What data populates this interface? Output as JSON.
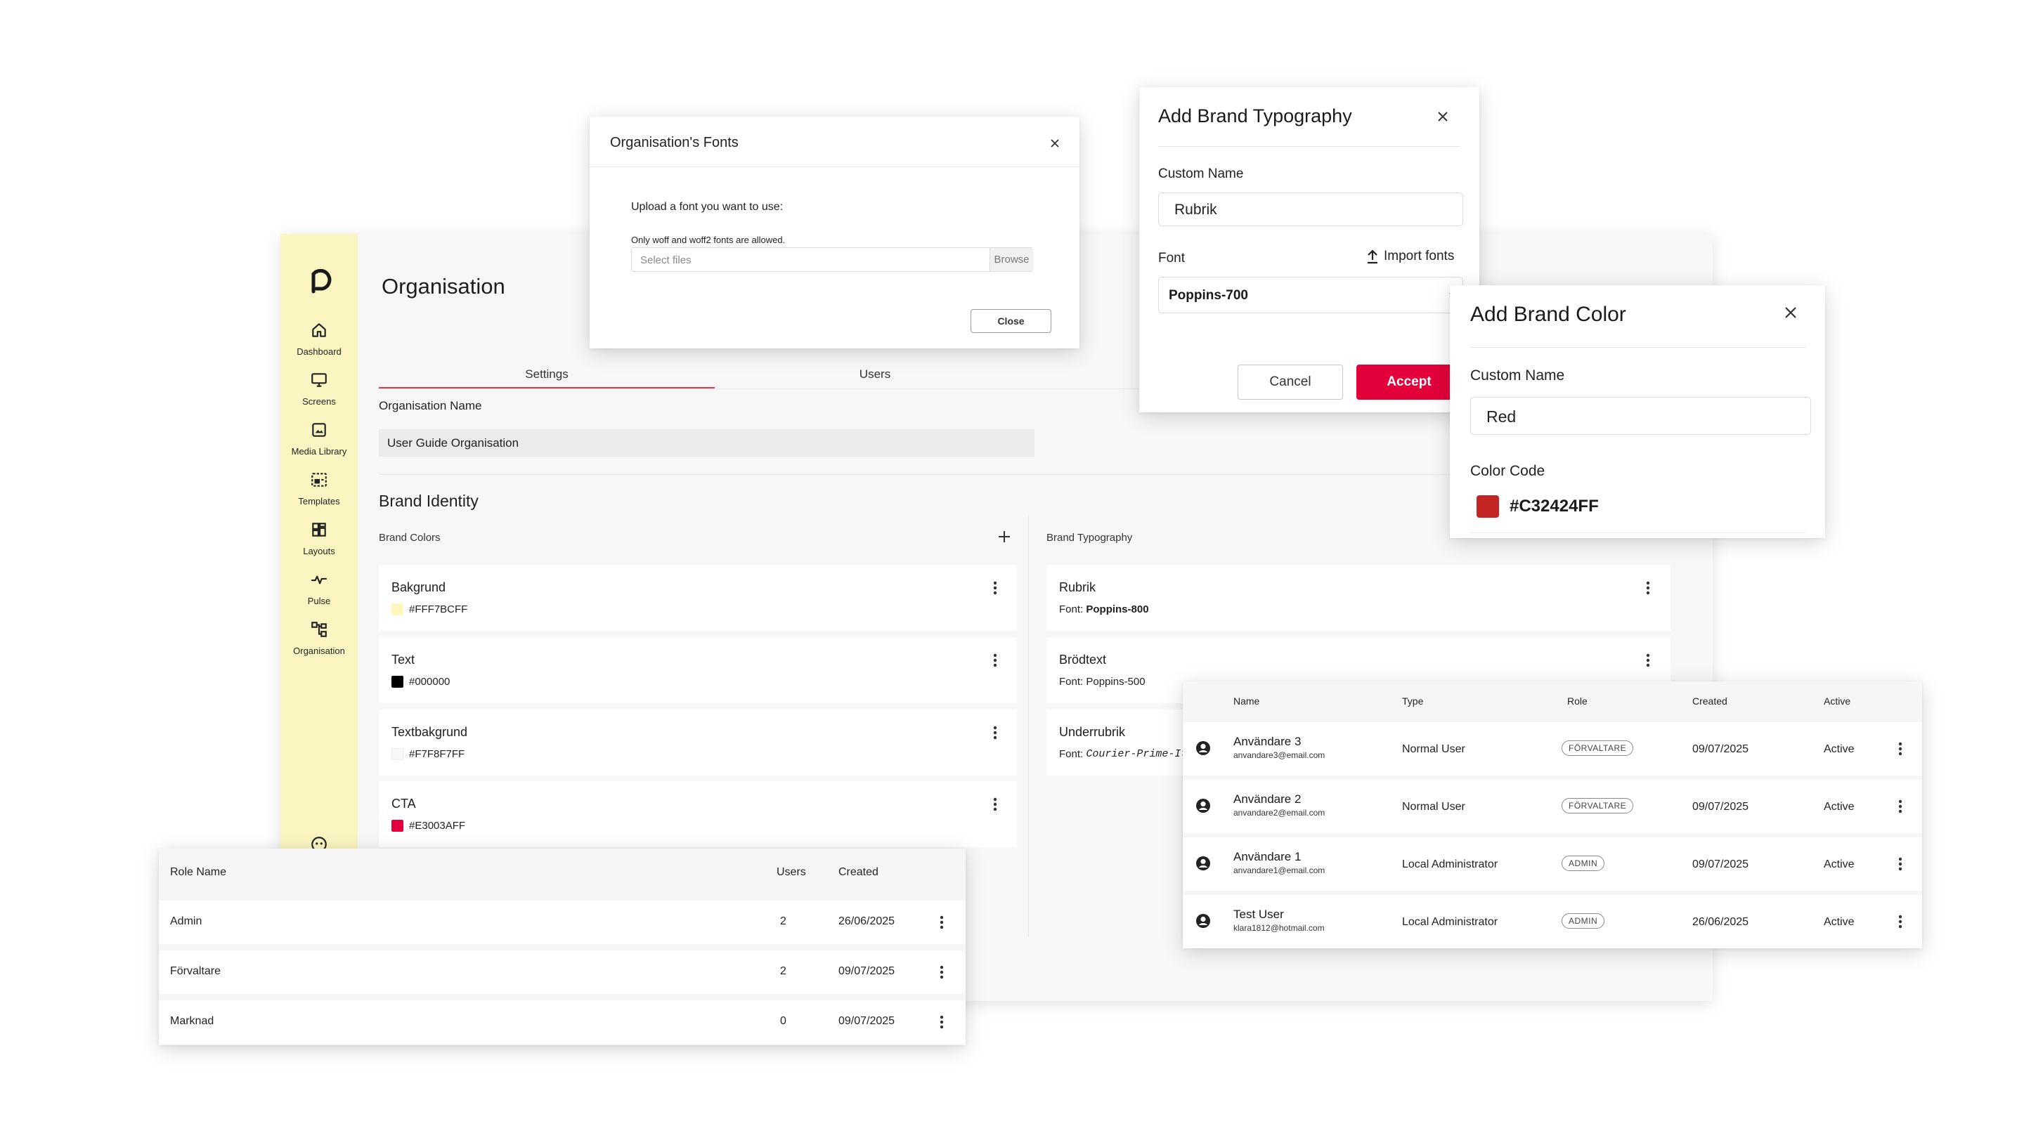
{
  "app": {
    "page_title": "Organisation",
    "nav": [
      {
        "label": "Dashboard",
        "icon": "home-icon"
      },
      {
        "label": "Screens",
        "icon": "monitor-icon"
      },
      {
        "label": "Media Library",
        "icon": "image-icon"
      },
      {
        "label": "Templates",
        "icon": "template-icon"
      },
      {
        "label": "Layouts",
        "icon": "grid-icon"
      },
      {
        "label": "Pulse",
        "icon": "pulse-icon"
      },
      {
        "label": "Organisation",
        "icon": "org-chart-icon"
      }
    ],
    "tabs": [
      {
        "label": "Settings",
        "active": true
      },
      {
        "label": "Users",
        "active": false
      }
    ],
    "org_name_label": "Organisation Name",
    "org_name_value": "User Guide Organisation",
    "brand_identity_title": "Brand Identity",
    "brand_colors_title": "Brand Colors",
    "brand_typography_title": "Brand Typography",
    "brand_colors": [
      {
        "name": "Bakgrund",
        "code": "#FFF7BCFF",
        "color": "#fff7bc"
      },
      {
        "name": "Text",
        "code": "#000000",
        "color": "#000000"
      },
      {
        "name": "Textbakgrund",
        "code": "#F7F8F7FF",
        "color": "#f7f8f7"
      },
      {
        "name": "CTA",
        "code": "#E3003AFF",
        "color": "#e3003a"
      }
    ],
    "brand_typography": [
      {
        "name": "Rubrik",
        "font_prefix": "Font:",
        "font": "Poppins-800"
      },
      {
        "name": "Brödtext",
        "font_prefix": "Font:",
        "font": "Poppins-500"
      },
      {
        "name": "Underrubrik",
        "font_prefix": "Font:",
        "font": "Courier-Prime-It"
      }
    ]
  },
  "fonts_dialog": {
    "title": "Organisation's Fonts",
    "upload_prompt": "Upload a font you want to use:",
    "hint": "Only woff and woff2 fonts are allowed.",
    "file_placeholder": "Select files",
    "browse_label": "Browse",
    "close_label": "Close"
  },
  "typography_dialog": {
    "title": "Add Brand Typography",
    "custom_name_label": "Custom Name",
    "custom_name_value": "Rubrik",
    "font_label": "Font",
    "import_label": "Import fonts",
    "font_value": "Poppins-700",
    "cancel_label": "Cancel",
    "accept_label": "Accept"
  },
  "color_dialog": {
    "title": "Add Brand Color",
    "custom_name_label": "Custom Name",
    "custom_name_value": "Red",
    "color_code_label": "Color Code",
    "color_code_value": "#C32424FF",
    "swatch_color": "#c32424"
  },
  "users_table": {
    "headers": {
      "name": "Name",
      "type": "Type",
      "role": "Role",
      "created": "Created",
      "active": "Active"
    },
    "rows": [
      {
        "name": "Användare 3",
        "email": "anvandare3@email.com",
        "type": "Normal User",
        "role": "FÖRVALTARE",
        "created": "09/07/2025",
        "active": "Active"
      },
      {
        "name": "Användare 2",
        "email": "anvandare2@email.com",
        "type": "Normal User",
        "role": "FÖRVALTARE",
        "created": "09/07/2025",
        "active": "Active"
      },
      {
        "name": "Användare 1",
        "email": "anvandare1@email.com",
        "type": "Local Administrator",
        "role": "ADMIN",
        "created": "09/07/2025",
        "active": "Active"
      },
      {
        "name": "Test User",
        "email": "klara1812@hotmail.com",
        "type": "Local Administrator",
        "role": "ADMIN",
        "created": "26/06/2025",
        "active": "Active"
      }
    ]
  },
  "roles_table": {
    "headers": {
      "role_name": "Role Name",
      "users": "Users",
      "created": "Created"
    },
    "rows": [
      {
        "name": "Admin",
        "users": "2",
        "created": "26/06/2025"
      },
      {
        "name": "Förvaltare",
        "users": "2",
        "created": "09/07/2025"
      },
      {
        "name": "Marknad",
        "users": "0",
        "created": "09/07/2025"
      }
    ]
  },
  "colors": {
    "accent": "#e3003a",
    "sidebar": "#fbf5c2"
  }
}
